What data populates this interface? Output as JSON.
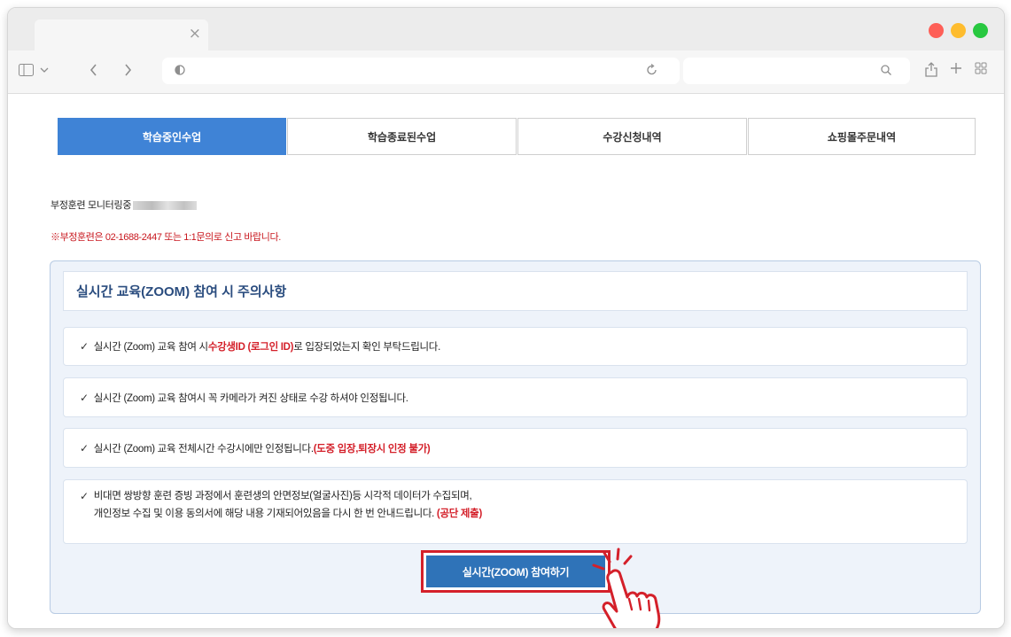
{
  "browser": {
    "tab_close": "×",
    "traffic_colors": [
      "#fe5f57",
      "#febc2e",
      "#28c840"
    ],
    "icons": [
      "sidebar-icon",
      "chevron-down-icon",
      "back-icon",
      "forward-icon",
      "shield-icon",
      "reload-icon",
      "search-icon",
      "share-icon",
      "new-tab-icon",
      "tab-overview-icon"
    ]
  },
  "nav": {
    "tabs": [
      {
        "label": "학습중인수업",
        "active": true
      },
      {
        "label": "학습종료된수업",
        "active": false
      },
      {
        "label": "수강신청내역",
        "active": false
      },
      {
        "label": "쇼핑몰주문내역",
        "active": false
      }
    ]
  },
  "monitor_label": "부정훈련 모니터링중",
  "warning": "※부정훈련은 02-1688-2447 또는 1:1문의로 신고 바랍니다.",
  "notice": {
    "title": "실시간 교육(ZOOM) 참여 시 주의사항",
    "check": "✓",
    "items": [
      {
        "pre": "실시간 (Zoom) 교육 참여 시 ",
        "highlight": "수강생ID (로그인 ID)",
        "post": "로 입장되었는지 확인 부탁드립니다."
      },
      {
        "pre": "실시간 (Zoom) 교육 참여시 꼭 카메라가 켜진 상태로 수강 하셔야 인정됩니다.",
        "highlight": "",
        "post": ""
      },
      {
        "pre": "실시간 (Zoom) 교육 전체시간 수강시에만 인정됩니다.",
        "highlight": "(도중 입장,퇴장시 인정 불가)",
        "post": ""
      },
      {
        "line1": "비대면 쌍방향 훈련 증빙 과정에서 훈련생의 안면정보(얼굴사진)등 시각적 데이터가 수집되며,",
        "pre": "개인정보 수집 및 이용 동의서에 해당 내용 기재되어있음을 다시 한 번 안내드립니다. ",
        "highlight": "(공단 제출)",
        "post": ""
      }
    ]
  },
  "zoom_button": "실시간(ZOOM) 참여하기",
  "accent_color": "#d4202a",
  "brand_color": "#3f83d6"
}
